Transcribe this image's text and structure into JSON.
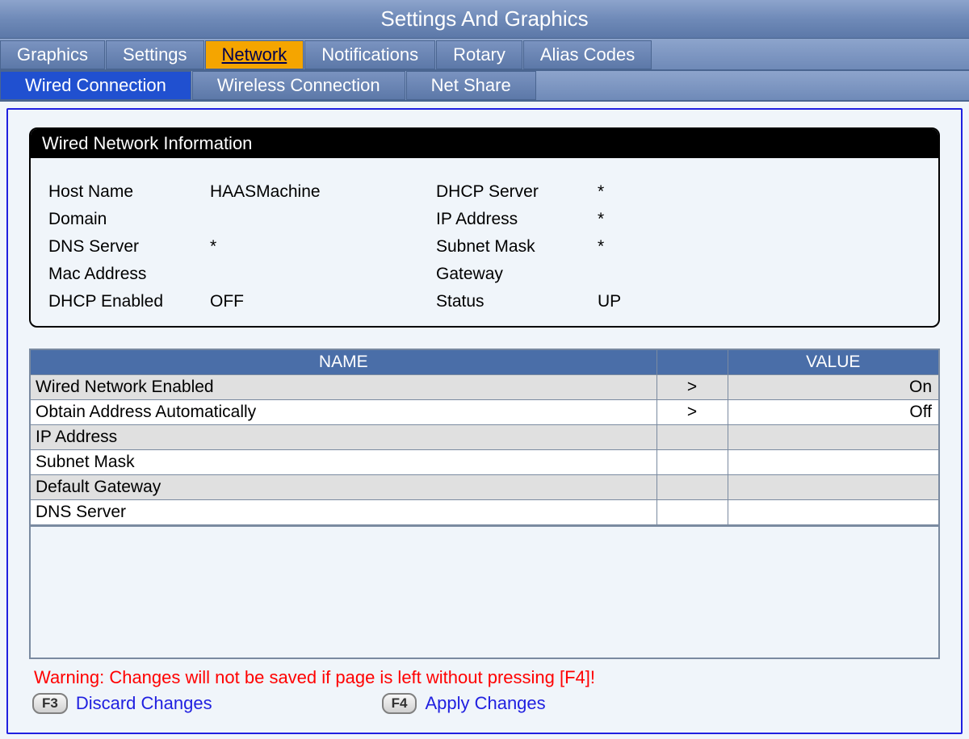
{
  "window_title": "Settings And Graphics",
  "primary_tabs": [
    {
      "label": "Graphics",
      "active": false
    },
    {
      "label": "Settings",
      "active": false
    },
    {
      "label": "Network",
      "active": true
    },
    {
      "label": "Notifications",
      "active": false
    },
    {
      "label": "Rotary",
      "active": false
    },
    {
      "label": "Alias Codes",
      "active": false
    }
  ],
  "secondary_tabs": [
    {
      "label": "Wired Connection",
      "active": true
    },
    {
      "label": "Wireless Connection",
      "active": false
    },
    {
      "label": "Net Share",
      "active": false
    }
  ],
  "info_box": {
    "title": "Wired Network Information",
    "left_rows": [
      {
        "label": "Host Name",
        "value": "HAASMachine"
      },
      {
        "label": "Domain",
        "value": ""
      },
      {
        "label": "DNS Server",
        "value": "*"
      },
      {
        "label": "Mac Address",
        "value": ""
      },
      {
        "label": "DHCP Enabled",
        "value": "OFF"
      }
    ],
    "right_rows": [
      {
        "label": "DHCP Server",
        "value": "*"
      },
      {
        "label": "IP Address",
        "value": "*"
      },
      {
        "label": "Subnet Mask",
        "value": "*"
      },
      {
        "label": "Gateway",
        "value": ""
      },
      {
        "label": "Status",
        "value": "UP"
      }
    ]
  },
  "settings_headers": {
    "name": "NAME",
    "indicator": "",
    "value": "VALUE"
  },
  "settings_rows": [
    {
      "name": "Wired Network Enabled",
      "indicator": ">",
      "value": "On",
      "shade": "even"
    },
    {
      "name": "Obtain Address Automatically",
      "indicator": ">",
      "value": "Off",
      "shade": "odd"
    },
    {
      "name": "IP Address",
      "indicator": "",
      "value": "",
      "shade": "even"
    },
    {
      "name": "Subnet Mask",
      "indicator": "",
      "value": "",
      "shade": "odd"
    },
    {
      "name": "Default Gateway",
      "indicator": "",
      "value": "",
      "shade": "even"
    },
    {
      "name": "DNS Server",
      "indicator": "",
      "value": "",
      "shade": "odd"
    }
  ],
  "warning": "Warning: Changes will not be saved if page is left without pressing [F4]!",
  "actions": {
    "discard": {
      "key": "F3",
      "label": "Discard Changes"
    },
    "apply": {
      "key": "F4",
      "label": "Apply Changes"
    }
  }
}
